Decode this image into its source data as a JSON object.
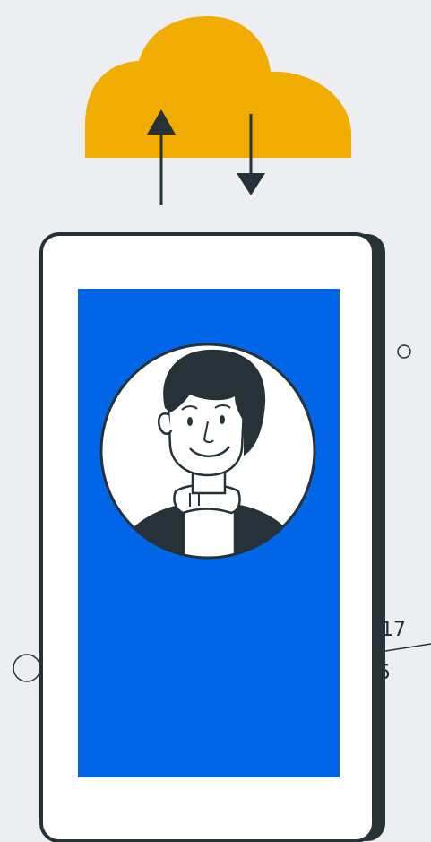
{
  "colors": {
    "background": "#ECEEF1",
    "cloud": "#F0AD00",
    "outline": "#263238",
    "screen": "#0066E8",
    "phone_body": "#FFFFFF"
  },
  "icons": {
    "cloud": "cloud-icon",
    "upload": "upload-arrow-icon",
    "download": "download-arrow-icon",
    "avatar": "user-avatar-icon"
  },
  "doodle": {
    "numerator": "17",
    "denominator": "5"
  }
}
